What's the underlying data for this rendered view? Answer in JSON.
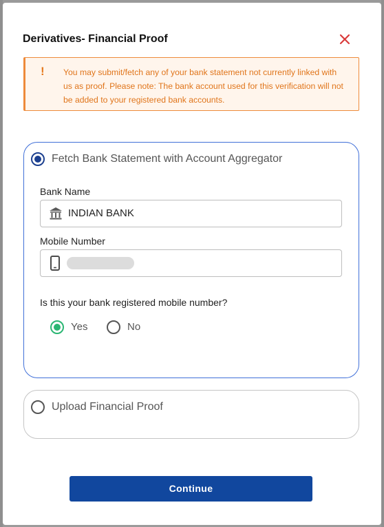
{
  "modal": {
    "title": "Derivatives- Financial Proof",
    "close_icon": "close-icon"
  },
  "warning": {
    "icon": "!",
    "message": "You may submit/fetch any of your bank statement not currently linked with us as proof. Please note: The bank account used for this verification will not be added to your registered bank accounts."
  },
  "option_aggregator": {
    "label": "Fetch Bank Statement with Account Aggregator",
    "selected": true,
    "bank_name_label": "Bank Name",
    "bank_name_value": "INDIAN BANK",
    "bank_icon": "bank-icon",
    "mobile_label": "Mobile Number",
    "mobile_icon": "mobile-phone-icon",
    "question": "Is this your bank registered mobile number?",
    "answers": [
      {
        "label": "Yes",
        "selected": true
      },
      {
        "label": "No",
        "selected": false
      }
    ]
  },
  "option_upload": {
    "label": "Upload Financial Proof",
    "selected": false
  },
  "footer": {
    "continue_label": "Continue"
  },
  "colors": {
    "primary": "#11479e",
    "accent_border": "#3f6fd8",
    "warning": "#e0751b",
    "close": "#d93a3a",
    "success": "#2bb673"
  }
}
